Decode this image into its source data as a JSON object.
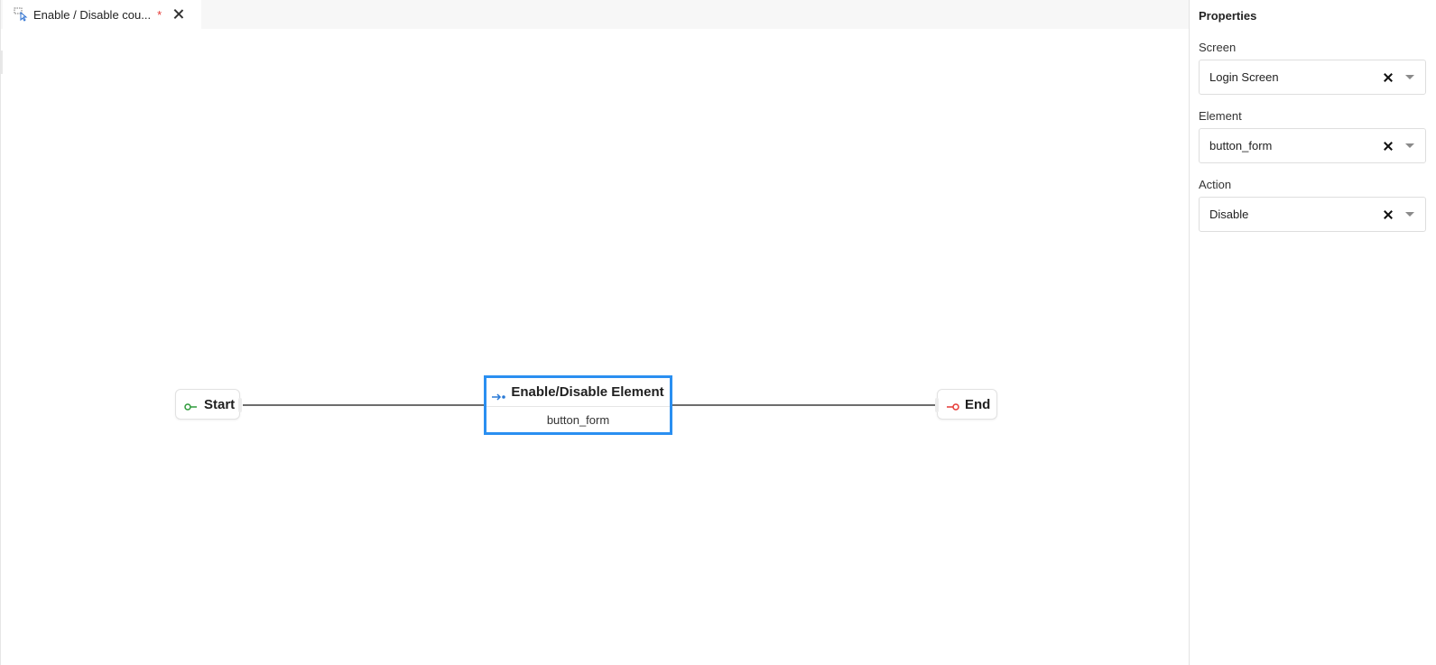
{
  "tab": {
    "title": "Enable / Disable cou...",
    "dirty_marker": "*"
  },
  "flow": {
    "start_label": "Start",
    "end_label": "End",
    "node": {
      "title": "Enable/Disable Element",
      "subtitle": "button_form"
    }
  },
  "properties": {
    "title": "Properties",
    "fields": [
      {
        "label": "Screen",
        "value": "Login Screen"
      },
      {
        "label": "Element",
        "value": "button_form"
      },
      {
        "label": "Action",
        "value": "Disable"
      }
    ]
  },
  "colors": {
    "selection_border": "#2a8ff1",
    "start_icon": "#2e9a3a",
    "end_icon": "#e53935",
    "dirty_marker": "#e53935"
  },
  "icons": {
    "tab": "flow-file-icon",
    "start": "start-node-icon",
    "end": "end-node-icon",
    "node": "enable-disable-icon"
  }
}
